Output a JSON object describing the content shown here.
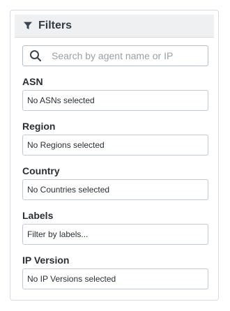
{
  "header": {
    "title": "Filters",
    "icon": "funnel-icon"
  },
  "search": {
    "placeholder": "Search by agent name or IP",
    "value": "",
    "icon": "search-icon"
  },
  "fields": [
    {
      "label": "ASN",
      "value": "No ASNs selected"
    },
    {
      "label": "Region",
      "value": "No Regions selected"
    },
    {
      "label": "Country",
      "value": "No Countries selected"
    },
    {
      "label": "Labels",
      "value": "Filter by labels..."
    },
    {
      "label": "IP Version",
      "value": "No IP Versions selected"
    }
  ]
}
